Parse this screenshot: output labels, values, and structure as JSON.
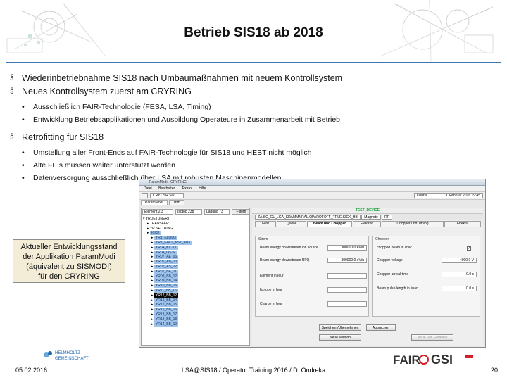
{
  "slide": {
    "title": "Betrieb SIS18 ab 2018",
    "bullets": [
      {
        "text": "Wiederinbetriebnahme SIS18 nach Umbaumaßnahmen mit neuem Kontrollsystem"
      },
      {
        "text": "Neues Kontrollsystem zuerst am CRYRING",
        "sub": [
          "Ausschließlich FAIR-Technologie (FESA, LSA, Timing)",
          "Entwicklung Betriebsapplikationen und Ausbildung Operateure in Zusammenarbeit mit Betrieb"
        ]
      },
      {
        "text": "Retrofitting für SIS18",
        "sub": [
          "Umstellung aller Front-Ends auf FAIR-Technologie für SIS18  und HEBT nicht möglich",
          "Alte FE‘s müssen weiter unterstützt werden",
          "Datenversorgung ausschließlich über LSA mit robusten Maschinenmodellen"
        ]
      }
    ],
    "bullet_marker_l1": "§",
    "bullet_marker_l2": "•",
    "callout": {
      "line1": "Aktueller Entwicklungsstand",
      "line2": "der Applikation ParamModi",
      "line3": "(äquivalent zu SISMODI)",
      "line4": "für den CRYRING"
    }
  },
  "app": {
    "window_title": "ParamModi - CRYRING",
    "menu": [
      "Datei",
      "Bearbeiten",
      "Extras",
      "Hilfe"
    ],
    "context_combo": "CRY.USR.SO",
    "language": "Deutsch",
    "date": "3. Februar 2016 19:45",
    "tabs": [
      "ParamModi",
      "Trim"
    ],
    "filter": {
      "element": "Element  2.3",
      "isotope": "Isotop 238",
      "charge": "Ladung  73",
      "button": "Filtern"
    },
    "tree_root": "YRDETUNERT",
    "tree": [
      {
        "label": "TRANSFER",
        "style": "plain"
      },
      {
        "label": "YR.SEC.RING",
        "style": "plain"
      },
      {
        "label": "KICK",
        "style": "hl"
      },
      {
        "label": "YR1_ELQD3",
        "style": "hl"
      },
      {
        "label": "YR1_EALT_KS1_AB3",
        "style": "hl"
      },
      {
        "label": "YR04_KICKT",
        "style": "hl"
      },
      {
        "label": "YR04_QS3F",
        "style": "hl"
      },
      {
        "label": "YR07_AE_06",
        "style": "hl"
      },
      {
        "label": "YR07_AB_13",
        "style": "hl"
      },
      {
        "label": "YR07_AS_12",
        "style": "hl"
      },
      {
        "label": "YR07_BE_11",
        "style": "hl"
      },
      {
        "label": "YR08_BB_12",
        "style": "hl"
      },
      {
        "label": "YR09_BB_14",
        "style": "hl"
      },
      {
        "label": "YR10_BB_15",
        "style": "hl"
      },
      {
        "label": "YR11_BB_16",
        "style": "hl"
      },
      {
        "label": "YR12_BB_12",
        "style": "sel"
      },
      {
        "label": "YR12_BB_14",
        "style": "hl"
      },
      {
        "label": "YR12_BB_15",
        "style": "hl"
      },
      {
        "label": "YR12_BB_16",
        "style": "hl"
      },
      {
        "label": "YR13_BB_17",
        "style": "hl"
      },
      {
        "label": "YR13_BB_18",
        "style": "hl"
      },
      {
        "label": "YR14_BB_19",
        "style": "hl"
      }
    ],
    "device": "TEST_DEVICE",
    "breadcrumb": [
      "ZA.SC_GL_LGA_KRAMMNRAL.QPAROFOFF_TRLE.KICK_BB",
      "Magnete",
      "RF"
    ],
    "subtabs": [
      "Fest",
      "Quelle",
      "Beam und Chopper",
      "Elektron",
      "Chopper und Timing",
      "Effektiv"
    ],
    "panel_left": {
      "heading": "Strom",
      "rows": [
        {
          "label": "Beam energy downstream ion source",
          "value": "300000.0 eV/u"
        },
        {
          "label": "Beam energy downstream RFQ",
          "value": "300000.0 eV/u"
        },
        {
          "label": "Element in Ieur",
          "value": ""
        },
        {
          "label": "Isotope in Ieur",
          "value": ""
        },
        {
          "label": "Charge in Ieur",
          "value": ""
        }
      ]
    },
    "panel_right": {
      "heading": "Chopper",
      "rows": [
        {
          "label": "chopped beam in linac",
          "value": "✓"
        },
        {
          "label": "Chopper voltage",
          "value": "4000.0 V"
        },
        {
          "label": "Chopper arrival time",
          "value": "0.0 s"
        },
        {
          "label": "Beam pulse length in linac",
          "value": "0.0 s"
        }
      ]
    },
    "buttons": {
      "save": "Speichern/Übernehmen",
      "cancel": "Abbrechen",
      "create": "Neue Version",
      "new_disabled": "Neue Ver. Erstellen"
    }
  },
  "footer": {
    "date": "05.02.2016",
    "center": "LSA@SIS18 / Operator Training 2016 / D. Ondreka",
    "page": "20",
    "helmholtz_line1": "HELMHOLTZ",
    "helmholtz_line2": "GEMEINSCHAFT",
    "fair": "FAIR",
    "gsi": "GSI"
  },
  "colors": {
    "accent_rule": "#3e73b4",
    "callout_bg": "#f3ecd7",
    "device_green": "#19a03c",
    "tree_hl": "#9ec3ea"
  }
}
